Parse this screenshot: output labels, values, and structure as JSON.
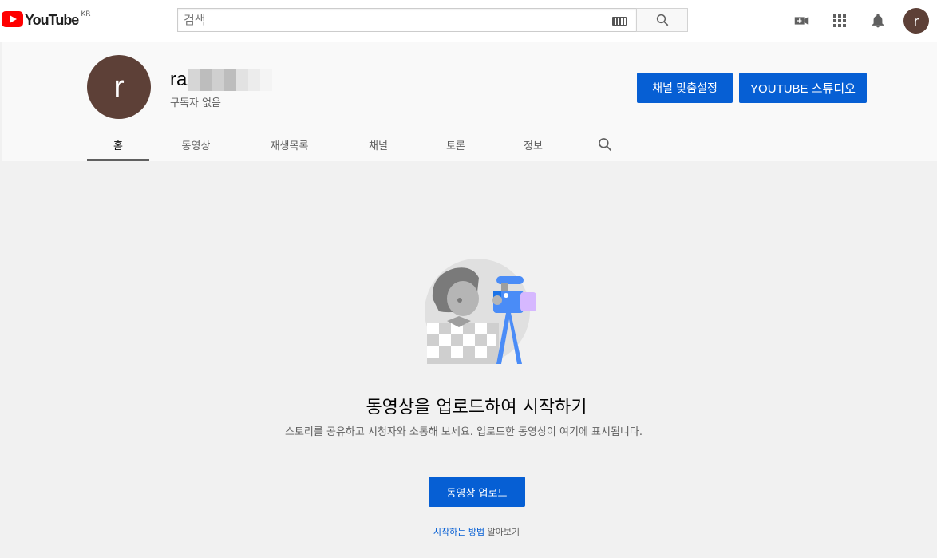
{
  "masthead": {
    "logo_text": "YouTube",
    "logo_region": "KR",
    "search_placeholder": "검색",
    "user_initial": "r"
  },
  "channel": {
    "initial": "r",
    "name_visible": "ra",
    "subscribers": "구독자 없음",
    "customize_label": "채널 맞춤설정",
    "studio_label": "YOUTUBE 스튜디오"
  },
  "tabs": [
    {
      "label": "홈",
      "active": true
    },
    {
      "label": "동영상"
    },
    {
      "label": "재생목록"
    },
    {
      "label": "채널"
    },
    {
      "label": "토론"
    },
    {
      "label": "정보"
    }
  ],
  "empty_state": {
    "title": "동영상을 업로드하여 시작하기",
    "description": "스토리를 공유하고 시청자와 소통해 보세요. 업로드한 동영상이 여기에 표시됩니다.",
    "upload_label": "동영상 업로드",
    "learn_link": "시작하는 방법",
    "learn_suffix": "알아보기"
  },
  "colors": {
    "accent": "#065fd4",
    "brand_red": "#ff0000",
    "avatar": "#5d4037"
  }
}
